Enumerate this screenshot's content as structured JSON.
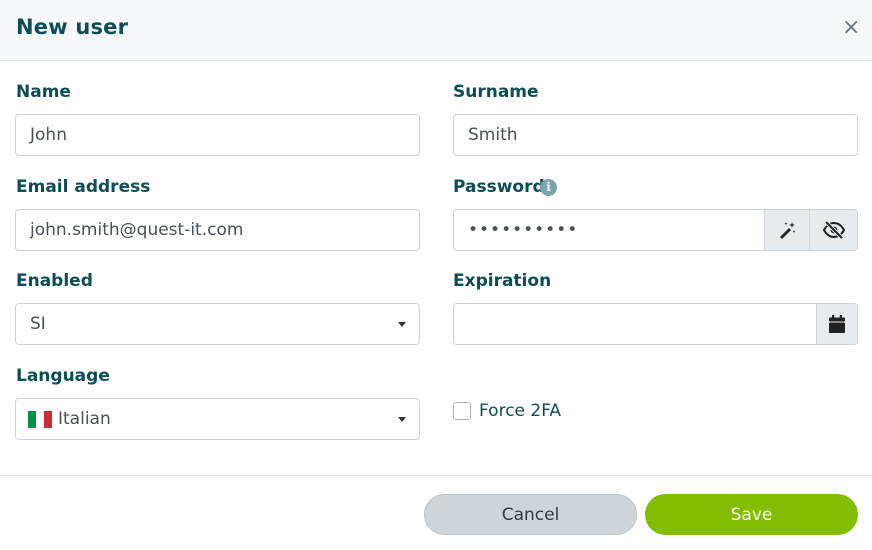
{
  "dialog": {
    "title": "New user",
    "close_glyph": "×"
  },
  "form": {
    "name": {
      "label": "Name",
      "value": "John"
    },
    "surname": {
      "label": "Surname",
      "value": "Smith"
    },
    "email": {
      "label": "Email address",
      "value": "john.smith@quest-it.com"
    },
    "password": {
      "label": "Password",
      "value": "••••••••••",
      "info_glyph": "i"
    },
    "enabled": {
      "label": "Enabled",
      "value": "SI"
    },
    "expiration": {
      "label": "Expiration",
      "value": ""
    },
    "language": {
      "label": "Language",
      "value": "Italian",
      "flag_colors": [
        "#009246",
        "#ffffff",
        "#ce2b37"
      ]
    },
    "force2fa": {
      "label": "Force 2FA",
      "checked": false
    }
  },
  "footer": {
    "cancel_label": "Cancel",
    "save_label": "Save"
  },
  "icons": {
    "close": "close-icon",
    "info": "info-icon",
    "generate": "magic-wand-icon",
    "toggle_visibility": "eye-slash-icon",
    "calendar": "calendar-icon",
    "caret": "caret-down-icon"
  },
  "colors": {
    "accent": "#82bd00",
    "text": "#0d4d55",
    "header_bg": "#f7f8fa"
  }
}
